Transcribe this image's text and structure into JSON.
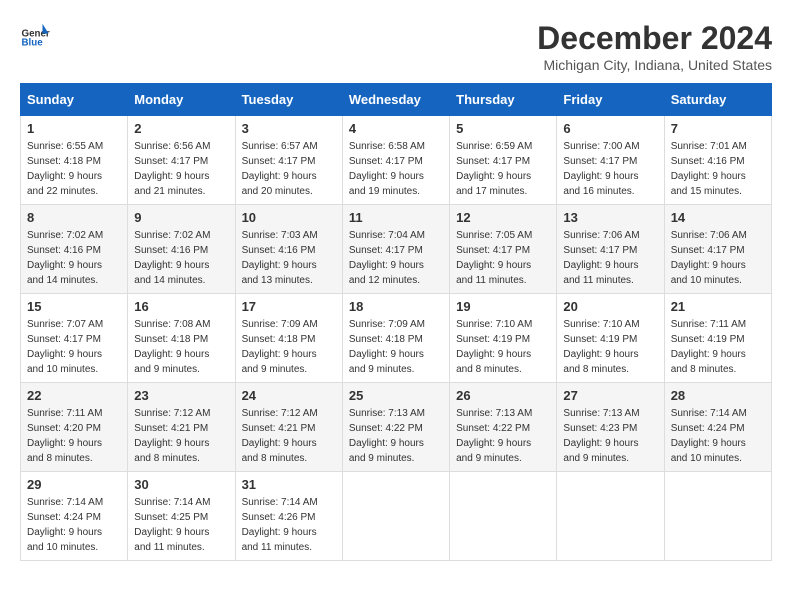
{
  "logo": {
    "general": "General",
    "blue": "Blue"
  },
  "title": "December 2024",
  "subtitle": "Michigan City, Indiana, United States",
  "weekdays": [
    "Sunday",
    "Monday",
    "Tuesday",
    "Wednesday",
    "Thursday",
    "Friday",
    "Saturday"
  ],
  "weeks": [
    [
      {
        "day": 1,
        "sunrise": "6:55 AM",
        "sunset": "4:18 PM",
        "daylight": "9 hours and 22 minutes."
      },
      {
        "day": 2,
        "sunrise": "6:56 AM",
        "sunset": "4:17 PM",
        "daylight": "9 hours and 21 minutes."
      },
      {
        "day": 3,
        "sunrise": "6:57 AM",
        "sunset": "4:17 PM",
        "daylight": "9 hours and 20 minutes."
      },
      {
        "day": 4,
        "sunrise": "6:58 AM",
        "sunset": "4:17 PM",
        "daylight": "9 hours and 19 minutes."
      },
      {
        "day": 5,
        "sunrise": "6:59 AM",
        "sunset": "4:17 PM",
        "daylight": "9 hours and 17 minutes."
      },
      {
        "day": 6,
        "sunrise": "7:00 AM",
        "sunset": "4:17 PM",
        "daylight": "9 hours and 16 minutes."
      },
      {
        "day": 7,
        "sunrise": "7:01 AM",
        "sunset": "4:16 PM",
        "daylight": "9 hours and 15 minutes."
      }
    ],
    [
      {
        "day": 8,
        "sunrise": "7:02 AM",
        "sunset": "4:16 PM",
        "daylight": "9 hours and 14 minutes."
      },
      {
        "day": 9,
        "sunrise": "7:02 AM",
        "sunset": "4:16 PM",
        "daylight": "9 hours and 14 minutes."
      },
      {
        "day": 10,
        "sunrise": "7:03 AM",
        "sunset": "4:16 PM",
        "daylight": "9 hours and 13 minutes."
      },
      {
        "day": 11,
        "sunrise": "7:04 AM",
        "sunset": "4:17 PM",
        "daylight": "9 hours and 12 minutes."
      },
      {
        "day": 12,
        "sunrise": "7:05 AM",
        "sunset": "4:17 PM",
        "daylight": "9 hours and 11 minutes."
      },
      {
        "day": 13,
        "sunrise": "7:06 AM",
        "sunset": "4:17 PM",
        "daylight": "9 hours and 11 minutes."
      },
      {
        "day": 14,
        "sunrise": "7:06 AM",
        "sunset": "4:17 PM",
        "daylight": "9 hours and 10 minutes."
      }
    ],
    [
      {
        "day": 15,
        "sunrise": "7:07 AM",
        "sunset": "4:17 PM",
        "daylight": "9 hours and 10 minutes."
      },
      {
        "day": 16,
        "sunrise": "7:08 AM",
        "sunset": "4:18 PM",
        "daylight": "9 hours and 9 minutes."
      },
      {
        "day": 17,
        "sunrise": "7:09 AM",
        "sunset": "4:18 PM",
        "daylight": "9 hours and 9 minutes."
      },
      {
        "day": 18,
        "sunrise": "7:09 AM",
        "sunset": "4:18 PM",
        "daylight": "9 hours and 9 minutes."
      },
      {
        "day": 19,
        "sunrise": "7:10 AM",
        "sunset": "4:19 PM",
        "daylight": "9 hours and 8 minutes."
      },
      {
        "day": 20,
        "sunrise": "7:10 AM",
        "sunset": "4:19 PM",
        "daylight": "9 hours and 8 minutes."
      },
      {
        "day": 21,
        "sunrise": "7:11 AM",
        "sunset": "4:19 PM",
        "daylight": "9 hours and 8 minutes."
      }
    ],
    [
      {
        "day": 22,
        "sunrise": "7:11 AM",
        "sunset": "4:20 PM",
        "daylight": "9 hours and 8 minutes."
      },
      {
        "day": 23,
        "sunrise": "7:12 AM",
        "sunset": "4:21 PM",
        "daylight": "9 hours and 8 minutes."
      },
      {
        "day": 24,
        "sunrise": "7:12 AM",
        "sunset": "4:21 PM",
        "daylight": "9 hours and 8 minutes."
      },
      {
        "day": 25,
        "sunrise": "7:13 AM",
        "sunset": "4:22 PM",
        "daylight": "9 hours and 9 minutes."
      },
      {
        "day": 26,
        "sunrise": "7:13 AM",
        "sunset": "4:22 PM",
        "daylight": "9 hours and 9 minutes."
      },
      {
        "day": 27,
        "sunrise": "7:13 AM",
        "sunset": "4:23 PM",
        "daylight": "9 hours and 9 minutes."
      },
      {
        "day": 28,
        "sunrise": "7:14 AM",
        "sunset": "4:24 PM",
        "daylight": "9 hours and 10 minutes."
      }
    ],
    [
      {
        "day": 29,
        "sunrise": "7:14 AM",
        "sunset": "4:24 PM",
        "daylight": "9 hours and 10 minutes."
      },
      {
        "day": 30,
        "sunrise": "7:14 AM",
        "sunset": "4:25 PM",
        "daylight": "9 hours and 11 minutes."
      },
      {
        "day": 31,
        "sunrise": "7:14 AM",
        "sunset": "4:26 PM",
        "daylight": "9 hours and 11 minutes."
      },
      null,
      null,
      null,
      null
    ]
  ]
}
